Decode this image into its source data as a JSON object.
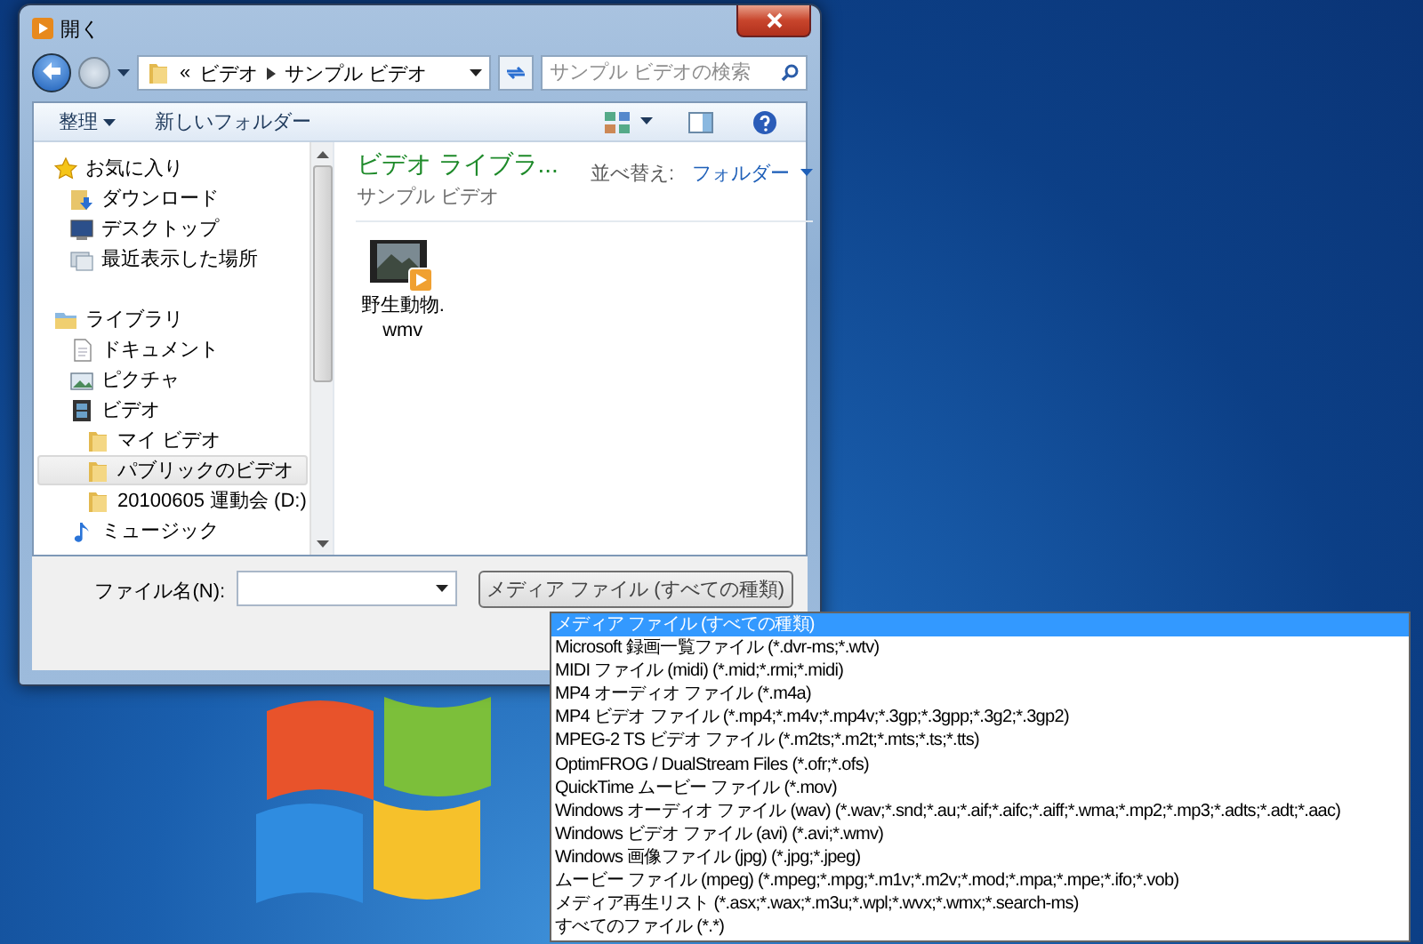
{
  "window": {
    "title": "開く"
  },
  "address_bar": {
    "overflow": "«",
    "path": [
      "ビデオ",
      "サンプル ビデオ"
    ]
  },
  "search": {
    "placeholder": "サンプル ビデオの検索"
  },
  "toolbar": {
    "organize": "整理",
    "new_folder": "新しいフォルダー"
  },
  "navigation": [
    {
      "label": "お気に入り",
      "kind": "star",
      "selected": false,
      "children": [
        {
          "label": "ダウンロード",
          "kind": "download",
          "selected": false
        },
        {
          "label": "デスクトップ",
          "kind": "desktop",
          "selected": false
        },
        {
          "label": "最近表示した場所",
          "kind": "recent",
          "selected": false
        }
      ]
    },
    {
      "label": "ライブラリ",
      "kind": "library",
      "selected": false,
      "children": [
        {
          "label": "ドキュメント",
          "kind": "document",
          "selected": false
        },
        {
          "label": "ピクチャ",
          "kind": "picture",
          "selected": false
        },
        {
          "label": "ビデオ",
          "kind": "video",
          "selected": false,
          "children": [
            {
              "label": "マイ ビデオ",
              "kind": "folder",
              "selected": false
            },
            {
              "label": "パブリックのビデオ",
              "kind": "folder",
              "selected": true
            },
            {
              "label": "20100605 運動会 (D:)",
              "kind": "folder",
              "selected": false
            }
          ]
        },
        {
          "label": "ミュージック",
          "kind": "music",
          "selected": false
        }
      ]
    }
  ],
  "content": {
    "title": "ビデオ ライブラ...",
    "subtitle": "サンプル ビデオ",
    "sort_label": "並べ替え:",
    "sort_value": "フォルダー",
    "files": [
      {
        "name": "野生動物.wmv"
      }
    ]
  },
  "footer": {
    "filename_label": "ファイル名(N):",
    "file_type": "メディア ファイル (すべての種類)"
  },
  "file_type_list": [
    {
      "label": "メディア ファイル (すべての種類)",
      "selected": true
    },
    {
      "label": "Microsoft 録画一覧ファイル (*.dvr-ms;*.wtv)",
      "selected": false
    },
    {
      "label": "MIDI ファイル (midi) (*.mid;*.rmi;*.midi)",
      "selected": false
    },
    {
      "label": "MP4 オーディオ ファイル (*.m4a)",
      "selected": false
    },
    {
      "label": "MP4 ビデオ ファイル (*.mp4;*.m4v;*.mp4v;*.3gp;*.3gpp;*.3g2;*.3gp2)",
      "selected": false
    },
    {
      "label": "MPEG-2 TS ビデオ ファイル (*.m2ts;*.m2t;*.mts;*.ts;*.tts)",
      "selected": false
    },
    {
      "label": "OptimFROG / DualStream Files (*.ofr;*.ofs)",
      "selected": false
    },
    {
      "label": "QuickTime ムービー ファイル (*.mov)",
      "selected": false
    },
    {
      "label": "Windows オーディオ ファイル (wav) (*.wav;*.snd;*.au;*.aif;*.aifc;*.aiff;*.wma;*.mp2;*.mp3;*.adts;*.adt;*.aac)",
      "selected": false
    },
    {
      "label": "Windows ビデオ ファイル (avi) (*.avi;*.wmv)",
      "selected": false
    },
    {
      "label": "Windows 画像ファイル (jpg) (*.jpg;*.jpeg)",
      "selected": false
    },
    {
      "label": "ムービー ファイル (mpeg) (*.mpeg;*.mpg;*.m1v;*.m2v;*.mod;*.mpa;*.mpe;*.ifo;*.vob)",
      "selected": false
    },
    {
      "label": "メディア再生リスト (*.asx;*.wax;*.m3u;*.wpl;*.wvx;*.wmx;*.search-ms)",
      "selected": false
    },
    {
      "label": "すべてのファイル (*.*)",
      "selected": false
    }
  ]
}
